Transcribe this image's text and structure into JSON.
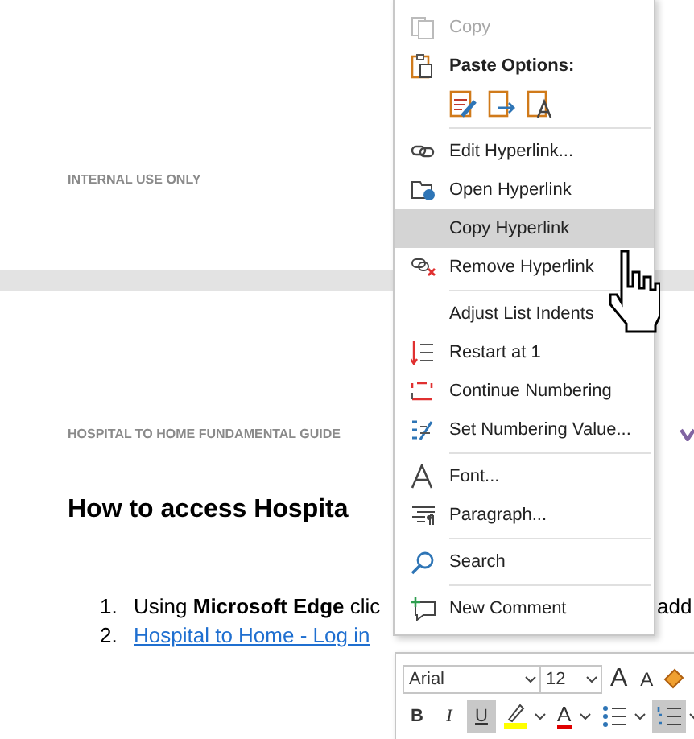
{
  "document": {
    "header": "INTERNAL USE ONLY",
    "section_title": "HOSPITAL TO HOME FUNDAMENTAL GUIDE",
    "heading": "How to access Hospita",
    "list": [
      {
        "number": "1.",
        "text": "Using **Microsoft Edge** clic",
        "text_after_menu": "add",
        "kind": "text"
      },
      {
        "number": "2.",
        "text": "Hospital to Home - Log in",
        "kind": "link"
      }
    ]
  },
  "context_menu": {
    "items": [
      {
        "kind": "item",
        "label": "Copy",
        "disabled": true,
        "selected": false
      },
      {
        "kind": "header",
        "label": "Paste Options:"
      },
      {
        "kind": "paste-row"
      },
      {
        "kind": "separator"
      },
      {
        "kind": "item",
        "label": "Edit Hyperlink...",
        "disabled": false,
        "selected": false
      },
      {
        "kind": "item",
        "label": "Open Hyperlink",
        "disabled": false,
        "selected": false
      },
      {
        "kind": "item",
        "label": "Copy Hyperlink",
        "disabled": false,
        "selected": true
      },
      {
        "kind": "item",
        "label": "Remove Hyperlink",
        "disabled": false,
        "selected": false
      },
      {
        "kind": "separator"
      },
      {
        "kind": "item",
        "label": "Adjust List Indents",
        "disabled": false,
        "selected": false
      },
      {
        "kind": "item",
        "label": "Restart at 1",
        "disabled": false,
        "selected": false
      },
      {
        "kind": "item",
        "label": "Continue Numbering",
        "disabled": false,
        "selected": false
      },
      {
        "kind": "item",
        "label": "Set Numbering Value...",
        "disabled": false,
        "selected": false
      },
      {
        "kind": "separator"
      },
      {
        "kind": "item",
        "label": "Font...",
        "disabled": false,
        "selected": false
      },
      {
        "kind": "item",
        "label": "Paragraph...",
        "disabled": false,
        "selected": false
      },
      {
        "kind": "separator"
      },
      {
        "kind": "item",
        "label": "Search",
        "disabled": false,
        "selected": false
      },
      {
        "kind": "separator"
      },
      {
        "kind": "item",
        "label": "New Comment",
        "disabled": false,
        "selected": false
      }
    ]
  },
  "mini_toolbar": {
    "font": "Arial",
    "size": "12",
    "grow_label": "A",
    "shrink_label": "A",
    "buttons": [
      {
        "kind": "bold",
        "label": "B",
        "selected": false
      },
      {
        "kind": "italic",
        "label": "I",
        "selected": false
      },
      {
        "kind": "underline",
        "label": "U",
        "selected": true
      },
      {
        "kind": "highlight",
        "selected": false
      },
      {
        "kind": "font-color",
        "label": "A",
        "selected": false
      },
      {
        "kind": "bullets",
        "selected": false
      },
      {
        "kind": "numbering",
        "selected": true
      }
    ]
  }
}
